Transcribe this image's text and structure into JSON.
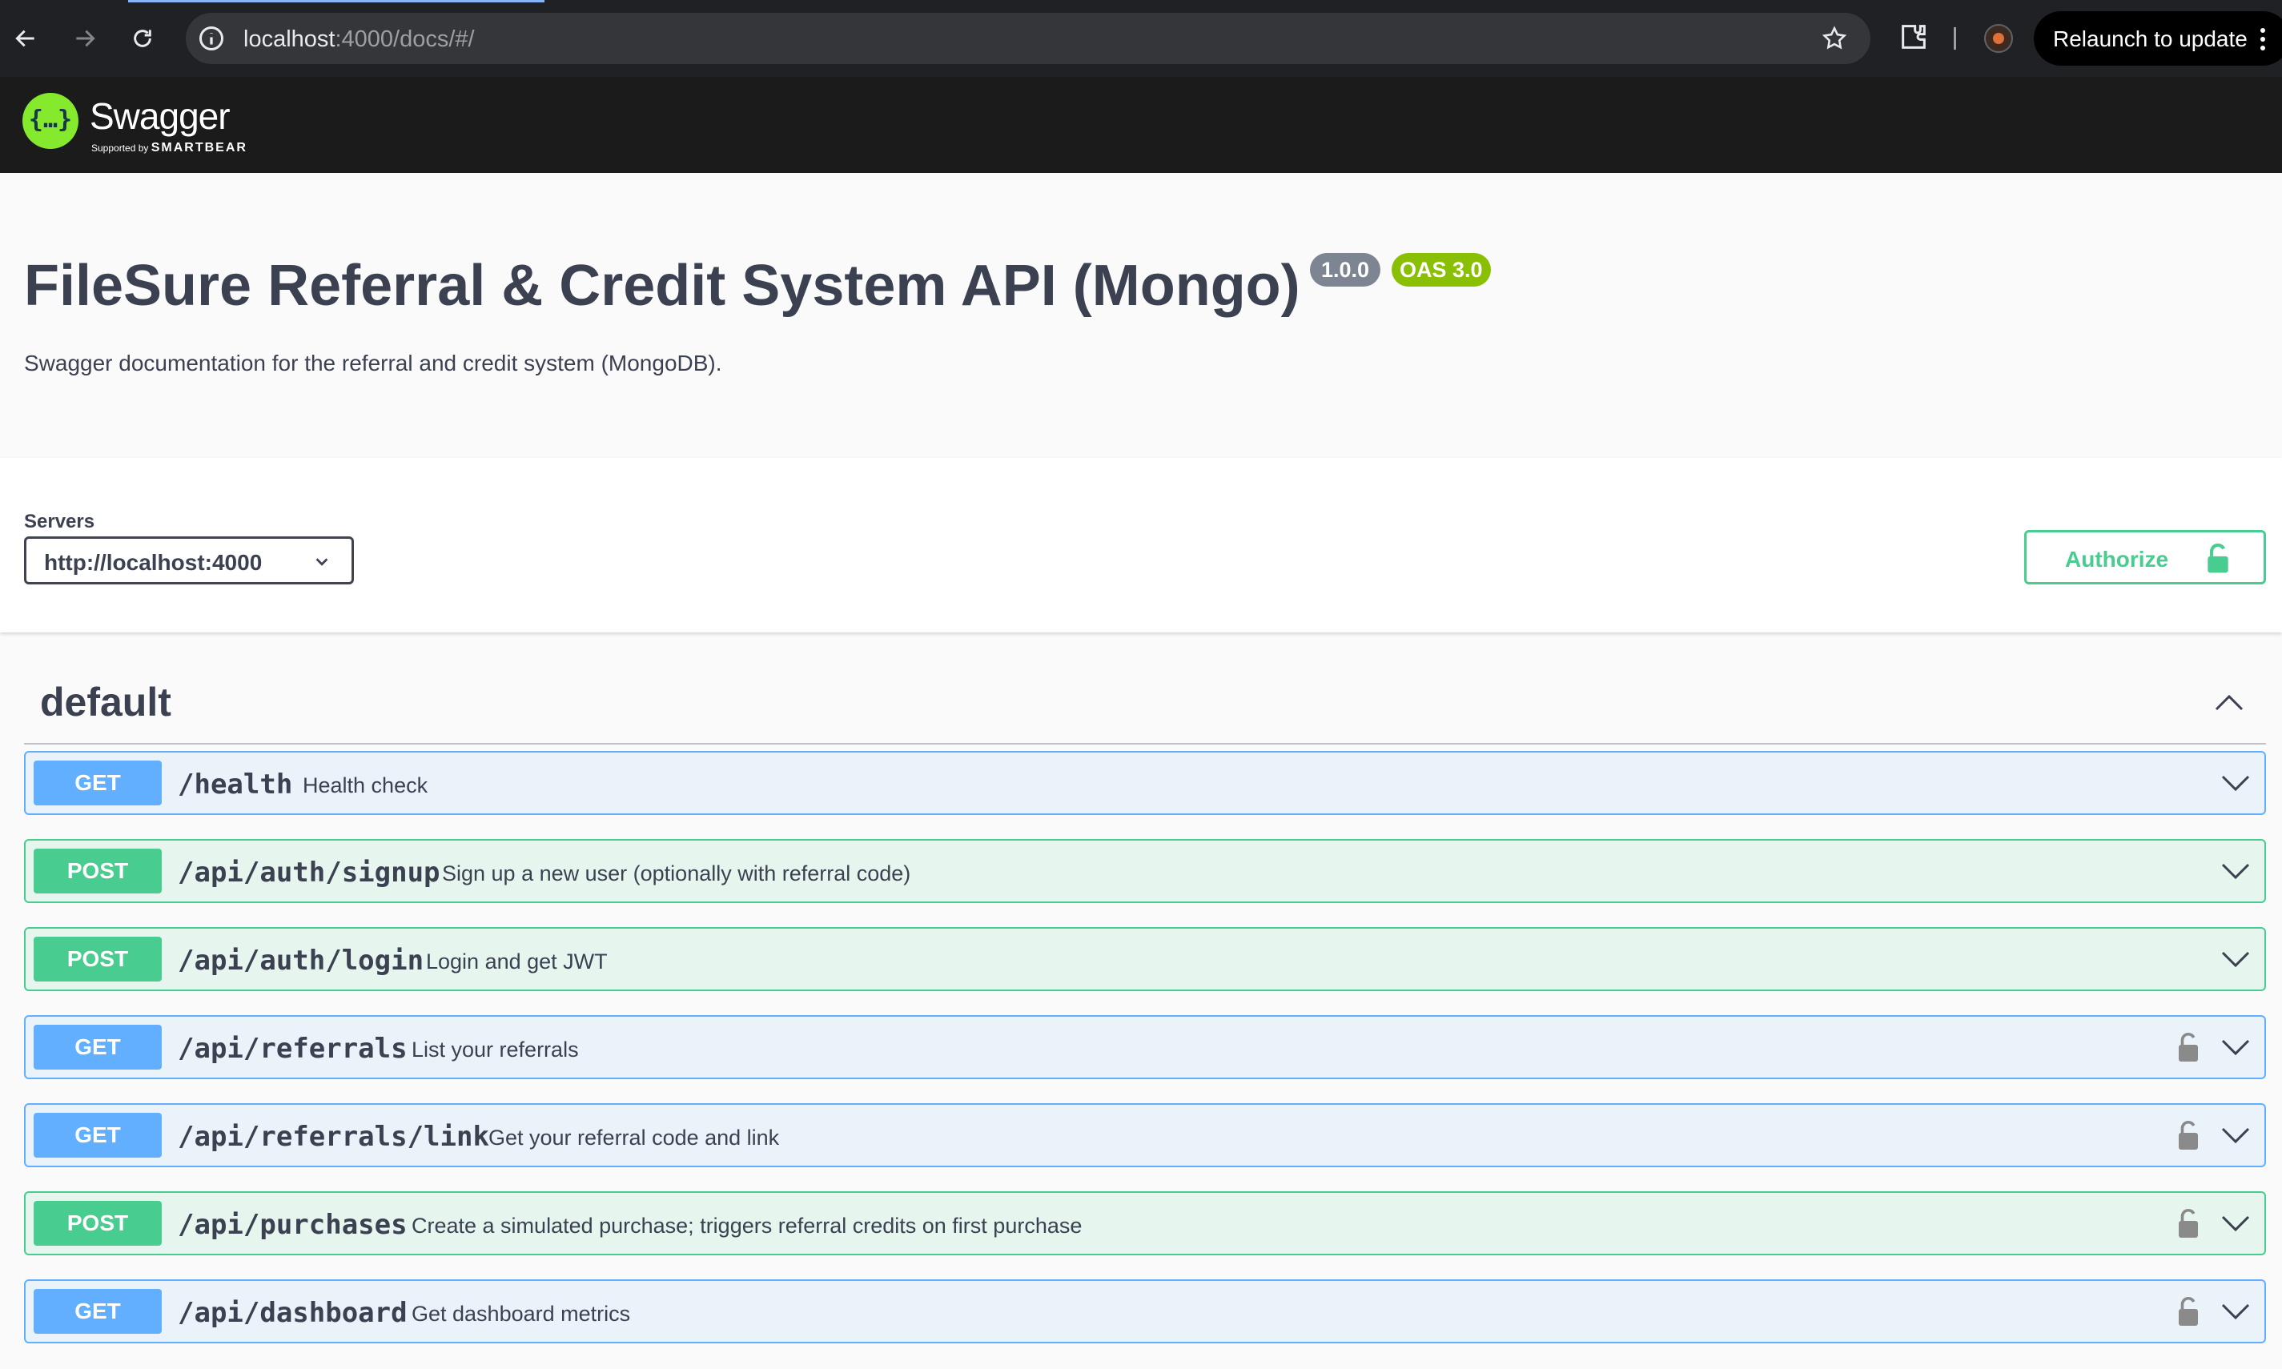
{
  "browser": {
    "url_host": "localhost",
    "url_rest": ":4000/docs/#/",
    "relaunch_label": "Relaunch to update"
  },
  "topbar": {
    "logo_text": "Swagger",
    "logo_sub_prefix": "Supported by",
    "logo_sub_brand": "SMARTBEAR",
    "logo_glyph": "{…}"
  },
  "info": {
    "title": "FileSure Referral & Credit System API (Mongo)",
    "version": "1.0.0",
    "oas": "OAS 3.0",
    "description": "Swagger documentation for the referral and credit system (MongoDB)."
  },
  "servers": {
    "label": "Servers",
    "selected": "http://localhost:4000",
    "authorize_label": "Authorize"
  },
  "tag": {
    "name": "default"
  },
  "operations": [
    {
      "method": "GET",
      "path": "/health",
      "summary": "Health check",
      "locked": false
    },
    {
      "method": "POST",
      "path": "/api/auth/signup",
      "summary": "Sign up a new user (optionally with referral code)",
      "locked": false
    },
    {
      "method": "POST",
      "path": "/api/auth/login",
      "summary": "Login and get JWT",
      "locked": false
    },
    {
      "method": "GET",
      "path": "/api/referrals",
      "summary": "List your referrals",
      "locked": true
    },
    {
      "method": "GET",
      "path": "/api/referrals/link",
      "summary": "Get your referral code and link",
      "locked": true
    },
    {
      "method": "POST",
      "path": "/api/purchases",
      "summary": "Create a simulated purchase; triggers referral credits on first purchase",
      "locked": true
    },
    {
      "method": "GET",
      "path": "/api/dashboard",
      "summary": "Get dashboard metrics",
      "locked": true
    }
  ],
  "colors": {
    "get": "#61affe",
    "post": "#49cc90",
    "authorize": "#49cc90",
    "swagger_green": "#85ea2d"
  }
}
